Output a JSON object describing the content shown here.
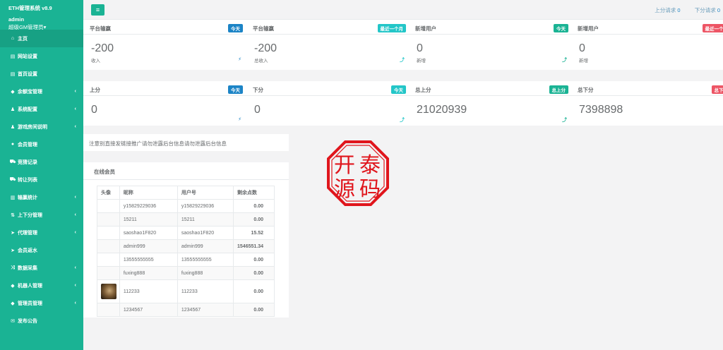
{
  "sidebar": {
    "system_name": "ETH管理系统 v8.9",
    "user": "admin",
    "role": "超级GM管理员",
    "items": [
      {
        "label": "主页",
        "icon": "home-icon",
        "glyph": "⌂",
        "chev": ""
      },
      {
        "label": "网站设置",
        "icon": "window-icon",
        "glyph": "▤",
        "chev": ""
      },
      {
        "label": "首页设置",
        "icon": "window-icon",
        "glyph": "▤",
        "chev": ""
      },
      {
        "label": "余额宝管理",
        "icon": "diamond-icon",
        "glyph": "◆",
        "chev": "‹"
      },
      {
        "label": "系统配置",
        "icon": "user-icon",
        "glyph": "♟",
        "chev": "‹"
      },
      {
        "label": "游戏房间说明",
        "icon": "user-icon",
        "glyph": "♟",
        "chev": "‹"
      },
      {
        "label": "会员管理",
        "icon": "user-icon",
        "glyph": "●",
        "chev": ""
      },
      {
        "label": "竞猜记录",
        "icon": "car-icon",
        "glyph": "⛟",
        "chev": ""
      },
      {
        "label": "转让列表",
        "icon": "car-icon",
        "glyph": "⛟",
        "chev": ""
      },
      {
        "label": "输赢统计",
        "icon": "chart-icon",
        "glyph": "▥",
        "chev": "‹"
      },
      {
        "label": "上下分管理",
        "icon": "updown-icon",
        "glyph": "⇅",
        "chev": "‹"
      },
      {
        "label": "代理管理",
        "icon": "send-icon",
        "glyph": "➤",
        "chev": "‹"
      },
      {
        "label": "会员返水",
        "icon": "send-icon",
        "glyph": "➤",
        "chev": ""
      },
      {
        "label": "数据采集",
        "icon": "random-icon",
        "glyph": "⤨",
        "chev": "‹"
      },
      {
        "label": "机器人管理",
        "icon": "diamond-icon",
        "glyph": "◆",
        "chev": "‹"
      },
      {
        "label": "管理员管理",
        "icon": "diamond-icon",
        "glyph": "◆",
        "chev": "‹"
      },
      {
        "label": "发布公告",
        "icon": "chat-icon",
        "glyph": "✉",
        "chev": ""
      }
    ]
  },
  "topbar": {
    "up_request_label": "上分请求",
    "up_request_count": "0",
    "down_request_label": "下分请求",
    "down_request_count": "0"
  },
  "cards": [
    {
      "title": "平台输赢",
      "badge": "今天",
      "badge_color": "#1c84c6",
      "value": "-200",
      "sub": "收入",
      "stat_icon": "⚡",
      "stat_color": "#1c84c6"
    },
    {
      "title": "平台输赢",
      "badge": "最近一个月",
      "badge_color": "#23c6c8",
      "value": "-200",
      "sub": "总收入",
      "stat_icon": "⤴",
      "stat_color": "#23c6c8"
    },
    {
      "title": "新增用户",
      "badge": "今天",
      "badge_color": "#1ab394",
      "value": "0",
      "sub": "新增",
      "stat_icon": "⤴",
      "stat_color": "#1ab394"
    },
    {
      "title": "新增用户",
      "badge": "最近一个月",
      "badge_color": "#ed5565",
      "value": "0",
      "sub": "新增",
      "stat_icon": "⤴",
      "stat_color": "#ed5565"
    },
    {
      "title": "上分",
      "badge": "今天",
      "badge_color": "#1c84c6",
      "value": "0",
      "sub": "",
      "stat_icon": "⚡",
      "stat_color": "#1c84c6"
    },
    {
      "title": "下分",
      "badge": "今天",
      "badge_color": "#23c6c8",
      "value": "0",
      "sub": "",
      "stat_icon": "⤴",
      "stat_color": "#23c6c8"
    },
    {
      "title": "总上分",
      "badge": "总上分",
      "badge_color": "#1ab394",
      "value": "21020939",
      "sub": "",
      "stat_icon": "⤴",
      "stat_color": "#1ab394"
    },
    {
      "title": "总下分",
      "badge": "总下分",
      "badge_color": "#ed5565",
      "value": "7398898",
      "sub": "",
      "stat_icon": "⤴",
      "stat_color": "#ed5565"
    }
  ],
  "notice": "注意别直接发链接推广请勿泄露后台信息请勿泄露后台信息",
  "online": {
    "title": "在线会员",
    "columns": [
      "头像",
      "昵称",
      "用户号",
      "剩余点数"
    ],
    "rows": [
      {
        "nick": "y15829229036",
        "uid": "y15829229036",
        "points": "0.00",
        "avatar": false
      },
      {
        "nick": "15211",
        "uid": "15211",
        "points": "0.00",
        "avatar": false
      },
      {
        "nick": "saoshao1F820",
        "uid": "saoshao1F820",
        "points": "15.52",
        "avatar": false
      },
      {
        "nick": "admin999",
        "uid": "admin999",
        "points": "1546551.34",
        "avatar": false
      },
      {
        "nick": "13555555555",
        "uid": "13555555555",
        "points": "0.00",
        "avatar": false
      },
      {
        "nick": "fuxing888",
        "uid": "fuxing888",
        "points": "0.00",
        "avatar": false
      },
      {
        "nick": "112233",
        "uid": "112233",
        "points": "0.00",
        "avatar": true
      },
      {
        "nick": "1234567",
        "uid": "1234567",
        "points": "0.00",
        "avatar": false
      }
    ]
  },
  "watermark": {
    "chars": [
      "开",
      "泰",
      "源",
      "码"
    ],
    "color": "#e0161d"
  }
}
